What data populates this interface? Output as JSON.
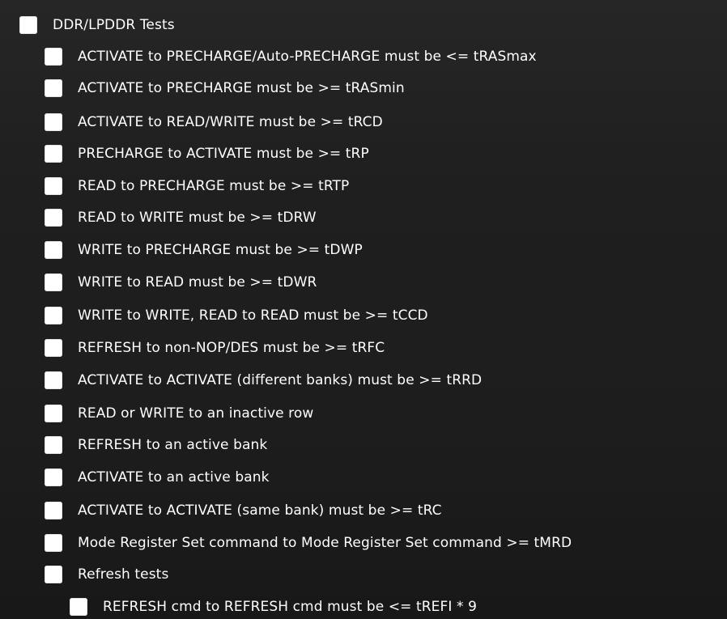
{
  "tree": {
    "root": {
      "label": "DDR/LPDDR Tests",
      "checked": false
    },
    "tests": [
      {
        "label": "ACTIVATE to PRECHARGE/Auto-PRECHARGE must be <= tRASmax",
        "checked": false
      },
      {
        "label": "ACTIVATE to PRECHARGE must be >= tRASmin",
        "checked": false
      },
      {
        "label": "ACTIVATE to READ/WRITE must be >= tRCD",
        "checked": false
      },
      {
        "label": "PRECHARGE to ACTIVATE must be >= tRP",
        "checked": false
      },
      {
        "label": "READ to PRECHARGE must be >= tRTP",
        "checked": false
      },
      {
        "label": "READ to WRITE must be >= tDRW",
        "checked": false
      },
      {
        "label": "WRITE to PRECHARGE must be >= tDWP",
        "checked": false
      },
      {
        "label": "WRITE to READ must be >= tDWR",
        "checked": false
      },
      {
        "label": "WRITE to WRITE, READ to READ must be >= tCCD",
        "checked": false
      },
      {
        "label": "REFRESH to non-NOP/DES must be >= tRFC",
        "checked": false
      },
      {
        "label": "ACTIVATE to ACTIVATE (different banks) must be >= tRRD",
        "checked": false
      },
      {
        "label": "READ or WRITE to an inactive row",
        "checked": false
      },
      {
        "label": "REFRESH to an active bank",
        "checked": false
      },
      {
        "label": "ACTIVATE to an active bank",
        "checked": false
      },
      {
        "label": "ACTIVATE to ACTIVATE (same bank) must be >= tRC",
        "checked": false
      },
      {
        "label": "Mode Register Set command to Mode Register Set command >= tMRD",
        "checked": false
      }
    ],
    "refresh_group": {
      "label": "Refresh tests",
      "checked": false,
      "children": [
        {
          "label": "REFRESH cmd to REFRESH cmd must be <= tREFI * 9",
          "checked": false
        }
      ]
    }
  }
}
